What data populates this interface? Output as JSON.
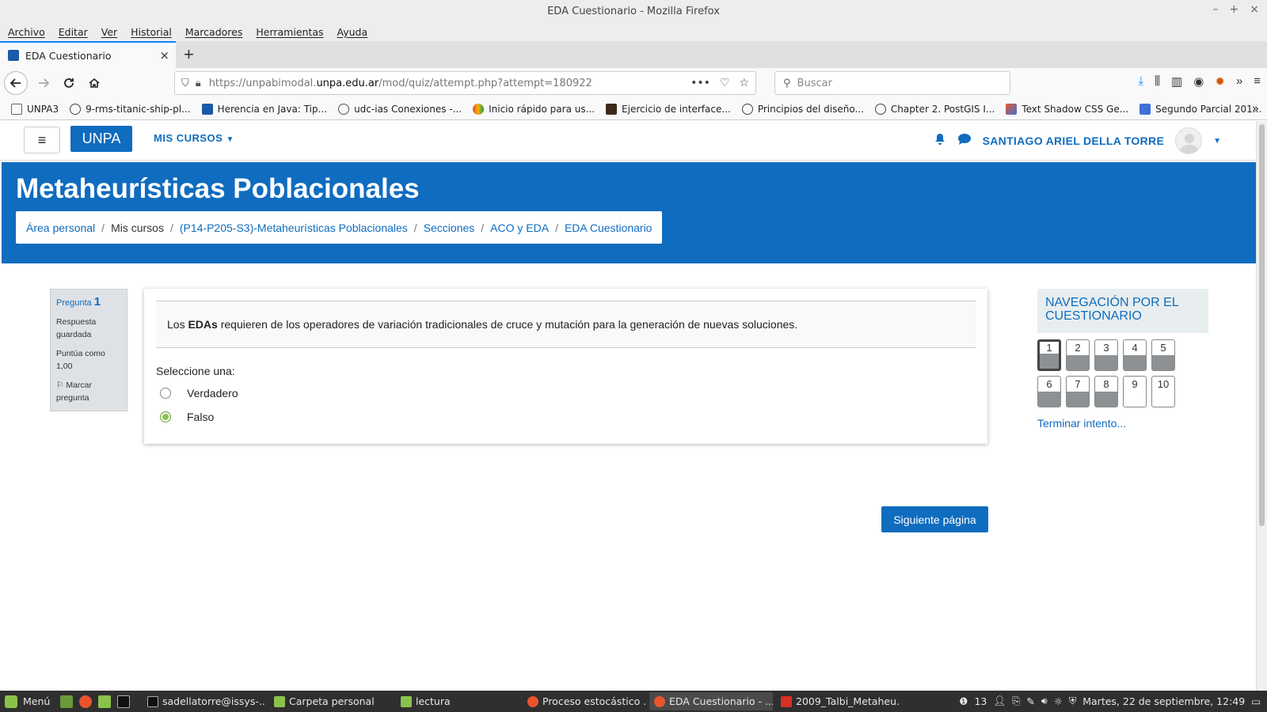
{
  "window": {
    "title": "EDA Cuestionario - Mozilla Firefox",
    "controls": [
      "–",
      "+",
      "×"
    ]
  },
  "menu": [
    "Archivo",
    "Editar",
    "Ver",
    "Historial",
    "Marcadores",
    "Herramientas",
    "Ayuda"
  ],
  "tab": {
    "title": "EDA Cuestionario",
    "close": "×",
    "new": "+"
  },
  "nav": {
    "url_prefix": "https://unpabimodal.",
    "url_host": "unpa.edu.ar",
    "url_path": "/mod/quiz/attempt.php?attempt=180922",
    "url_actions": "•••",
    "search_placeholder": "Buscar"
  },
  "bookmarks": [
    {
      "label": "UNPA3",
      "color": "#666666"
    },
    {
      "label": "9-rms-titanic-ship-pl...",
      "color": "#444444"
    },
    {
      "label": "Herencia en Java: Tip...",
      "color": "#1a5aa6"
    },
    {
      "label": "udc-ias Conexiones -...",
      "color": "#555555"
    },
    {
      "label": "Inicio rápido para us...",
      "color": "#e34b3c"
    },
    {
      "label": "Ejercicio de interface...",
      "color": "#3a2a1a"
    },
    {
      "label": "Principios del diseño...",
      "color": "#444444"
    },
    {
      "label": "Chapter 2. PostGIS I...",
      "color": "#444444"
    },
    {
      "label": "Text Shadow CSS Ge...",
      "color": "#e8552d"
    },
    {
      "label": "Segundo Parcial 201...",
      "color": "#3f6fd8"
    }
  ],
  "moodle": {
    "brand": "UNPA",
    "mis_cursos": "MIS CURSOS",
    "user": "SANTIAGO ARIEL DELLA TORRE",
    "course_title": "Metaheurísticas Poblacionales",
    "breadcrumb": [
      "Área personal",
      "Mis cursos",
      "(P14-P205-S3)-Metaheurísticas Poblacionales",
      "Secciones",
      "ACO y EDA",
      "EDA Cuestionario"
    ]
  },
  "question": {
    "label": "Pregunta",
    "number": "1",
    "status": "Respuesta guardada",
    "score": "Puntúa como 1,00",
    "flag": "Marcar pregunta",
    "text_before": "Los ",
    "text_bold": "EDAs",
    "text_after": " requieren de los operadores de variación tradicionales de cruce y mutación para la generación de nuevas soluciones.",
    "prompt": "Seleccione una:",
    "options": [
      {
        "label": "Verdadero",
        "selected": false
      },
      {
        "label": "Falso",
        "selected": true
      }
    ],
    "next": "Siguiente página"
  },
  "quiz_nav": {
    "title": "NAVEGACIÓN POR EL CUESTIONARIO",
    "buttons": [
      {
        "n": "1",
        "answered": true,
        "current": true
      },
      {
        "n": "2",
        "answered": true,
        "current": false
      },
      {
        "n": "3",
        "answered": true,
        "current": false
      },
      {
        "n": "4",
        "answered": true,
        "current": false
      },
      {
        "n": "5",
        "answered": true,
        "current": false
      },
      {
        "n": "6",
        "answered": true,
        "current": false
      },
      {
        "n": "7",
        "answered": true,
        "current": false
      },
      {
        "n": "8",
        "answered": true,
        "current": false
      },
      {
        "n": "9",
        "answered": false,
        "current": false
      },
      {
        "n": "10",
        "answered": false,
        "current": false
      }
    ],
    "finish": "Terminar intento..."
  },
  "taskbar": {
    "menu": "Menú",
    "items": [
      {
        "label": "sadellatorre@issys-...",
        "active": false
      },
      {
        "label": "Carpeta personal",
        "active": false
      },
      {
        "label": "lectura",
        "active": false
      },
      {
        "label": "Proceso estocástico ...",
        "active": false
      },
      {
        "label": "EDA Cuestionario - ...",
        "active": true
      },
      {
        "label": "2009_Talbi_Metaheu...",
        "active": false
      }
    ],
    "updates": "13",
    "clock": "Martes, 22 de septiembre, 12:49"
  }
}
